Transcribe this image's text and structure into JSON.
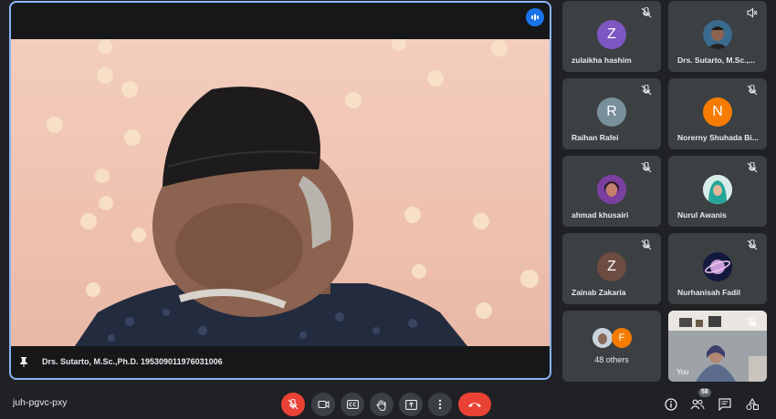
{
  "meeting": {
    "code": "juh-pgvc-pxy"
  },
  "main_speaker": {
    "name": "Drs. Sutarto, M.Sc.,Ph.D. 195309011976031006"
  },
  "participants": [
    {
      "name": "zulaikha hashim",
      "initial": "Z",
      "color": "#7e57c2"
    },
    {
      "name": "Drs. Sutarto, M.Sc.,...",
      "initial": "",
      "color": "#1f3b5a"
    },
    {
      "name": "Raihan Rafei",
      "initial": "R",
      "color": "#78909c"
    },
    {
      "name": "Norerny Shuhada Bi...",
      "initial": "N",
      "color": "#f57c00"
    },
    {
      "name": "ahmad khusairi",
      "initial": "",
      "color": "#6a3d9a"
    },
    {
      "name": "Nurul Awanis",
      "initial": "",
      "color": "#26a69a"
    },
    {
      "name": "Zainab Zakaria",
      "initial": "Z",
      "color": "#6d4c41"
    },
    {
      "name": "Nurhanisah Fadil",
      "initial": "",
      "color": "#283593"
    }
  ],
  "others": {
    "label": "48 others",
    "initial": "F",
    "color": "#f57c00"
  },
  "self_tile": {
    "label": "You"
  },
  "people_count": "58"
}
